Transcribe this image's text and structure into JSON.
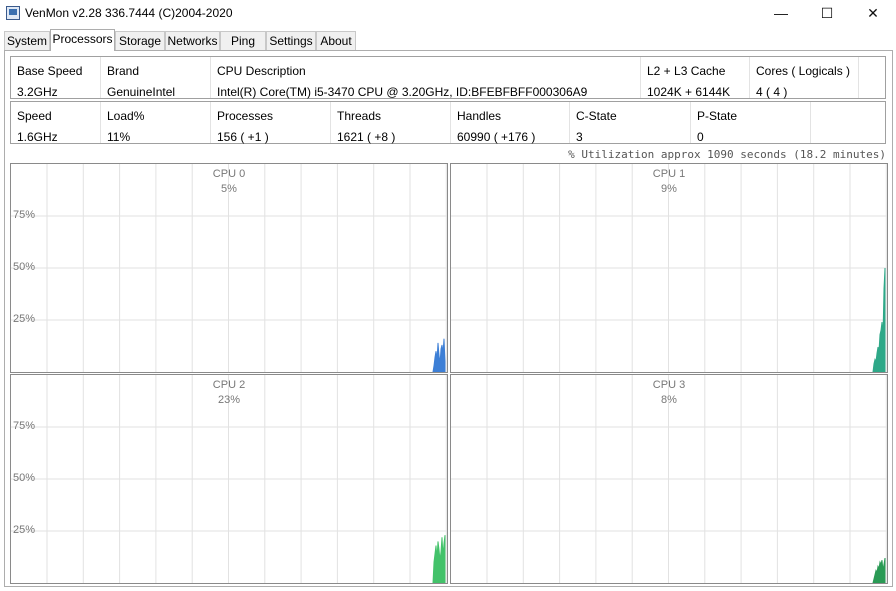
{
  "window": {
    "title": "VenMon v2.28 336.7444 (C)2004-2020",
    "minimize": "—",
    "maximize": "☐",
    "close": "✕"
  },
  "tabs": [
    {
      "label": "System",
      "active": false
    },
    {
      "label": "Processors",
      "active": true
    },
    {
      "label": "Storage",
      "active": false
    },
    {
      "label": "Networks",
      "active": false
    },
    {
      "label": "Ping",
      "active": false
    },
    {
      "label": "Settings",
      "active": false
    },
    {
      "label": "About",
      "active": false
    }
  ],
  "info_row1": [
    {
      "header": "Base Speed",
      "value": "3.2GHz"
    },
    {
      "header": "Brand",
      "value": "GenuineIntel"
    },
    {
      "header": "CPU Description",
      "value": "Intel(R) Core(TM) i5-3470 CPU @ 3.20GHz, ID:BFEBFBFF000306A9"
    },
    {
      "header": "L2 + L3 Cache",
      "value": "1024K + 6144K"
    },
    {
      "header": "Cores ( Logicals )",
      "value": "4 ( 4 )"
    }
  ],
  "info_row2": [
    {
      "header": "Speed",
      "value": "1.6GHz"
    },
    {
      "header": "Load%",
      "value": "11%"
    },
    {
      "header": "Processes",
      "value": "156  ( +1 )"
    },
    {
      "header": "Threads",
      "value": "1621  ( +8 )"
    },
    {
      "header": "Handles",
      "value": "60990  ( +176 )"
    },
    {
      "header": "C-State",
      "value": "3"
    },
    {
      "header": "P-State",
      "value": "0"
    }
  ],
  "utilization_note": "% Utilization approx 1090 seconds (18.2 minutes)",
  "axis_labels": [
    "75%",
    "50%",
    "25%"
  ],
  "cpus": [
    {
      "name": "CPU 0",
      "load": "5%",
      "color": "#3d7fd6",
      "history": [
        0,
        3,
        7,
        10,
        6,
        14,
        8,
        4,
        11,
        13,
        9,
        16,
        5
      ]
    },
    {
      "name": "CPU 1",
      "load": "9%",
      "color": "#2ea888",
      "history": [
        0,
        4,
        6,
        5,
        9,
        12,
        10,
        18,
        20,
        24,
        17,
        40,
        50
      ]
    },
    {
      "name": "CPU 2",
      "load": "23%",
      "color": "#43c26a",
      "history": [
        0,
        10,
        14,
        18,
        12,
        20,
        16,
        11,
        15,
        22,
        13,
        19,
        23
      ]
    },
    {
      "name": "CPU 3",
      "load": "8%",
      "color": "#2a9a55",
      "history": [
        0,
        2,
        4,
        6,
        5,
        8,
        7,
        10,
        9,
        11,
        6,
        9,
        12
      ]
    }
  ]
}
